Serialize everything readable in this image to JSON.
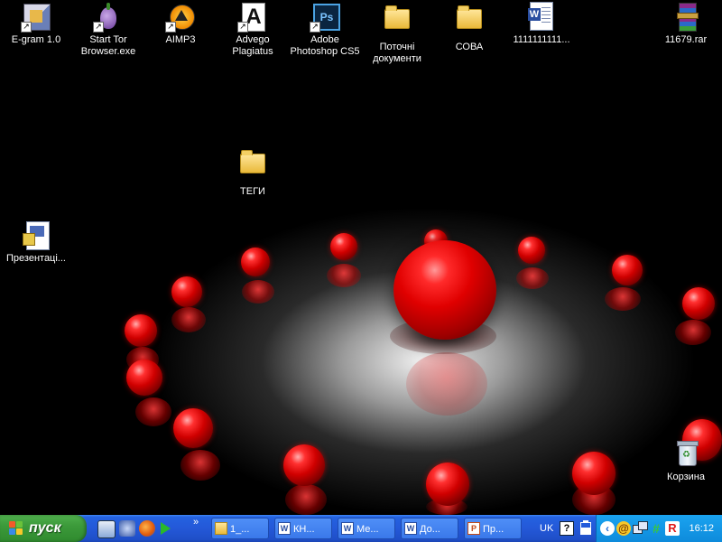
{
  "desktop": {
    "icons": [
      {
        "label": "E-gram 1.0",
        "icon": "e-gram-app-icon"
      },
      {
        "label": "Start Tor Browser.exe",
        "icon": "tor-onion-icon"
      },
      {
        "label": "AIMP3",
        "icon": "aimp-player-icon"
      },
      {
        "label": "Advego Plagiatus",
        "icon": "advego-a-icon"
      },
      {
        "label": "Adobe Photoshop CS5",
        "icon": "photoshop-icon"
      },
      {
        "label": "Поточні документи",
        "icon": "folder-icon"
      },
      {
        "label": "СОВА",
        "icon": "folder-icon"
      },
      {
        "label": "1111111111...",
        "icon": "word-document-icon"
      },
      {
        "label": "11679.rar",
        "icon": "rar-archive-icon"
      },
      {
        "label": "ТЕГИ",
        "icon": "folder-icon"
      },
      {
        "label": "Презентаці...",
        "icon": "presentation-file-icon"
      },
      {
        "label": "Корзина",
        "icon": "recycle-bin-icon"
      }
    ]
  },
  "taskbar": {
    "start_label": "пуск",
    "chevron": "»",
    "quick_launch": [
      {
        "icon": "show-desktop-icon"
      },
      {
        "icon": "network-icon"
      },
      {
        "icon": "firefox-icon"
      },
      {
        "icon": "play-icon"
      }
    ],
    "buttons": [
      {
        "label": "1_...",
        "icon": "folder-icon"
      },
      {
        "label": "КН...",
        "icon": "word-icon"
      },
      {
        "label": "Ме...",
        "icon": "word-icon"
      },
      {
        "label": "До...",
        "icon": "word-icon"
      },
      {
        "label": "Пр...",
        "icon": "powerpoint-icon"
      }
    ],
    "language": "UK",
    "tray": {
      "clock": "16:12",
      "icons": [
        "help-icon",
        "battery-icon",
        "back-arrow-icon",
        "at-sign-icon",
        "network-tray-icon",
        "hash-icon",
        "avira-icon"
      ]
    }
  },
  "colors": {
    "taskbar_blue": "#245edb",
    "start_green": "#3c9a3a",
    "tray_blue": "#0e8bdb",
    "ball_red": "#e00000"
  }
}
